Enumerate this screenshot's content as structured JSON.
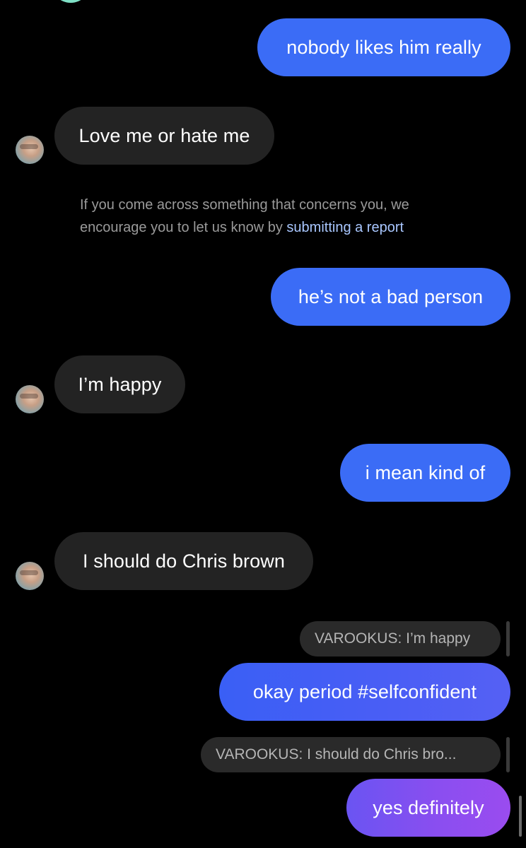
{
  "messages": [
    {
      "id": "m1",
      "direction": "sent",
      "text": "nobody likes him really"
    },
    {
      "id": "m2",
      "direction": "received",
      "text": "Love me or hate me"
    },
    {
      "id": "m3",
      "direction": "sent",
      "text": "he’s not a bad person"
    },
    {
      "id": "m4",
      "direction": "received",
      "text": "I’m happy"
    },
    {
      "id": "m5",
      "direction": "sent",
      "text": "i mean kind of"
    },
    {
      "id": "m6",
      "direction": "received",
      "text": "I should do Chris brown"
    },
    {
      "id": "m7",
      "direction": "sent",
      "text": "okay period #selfconfident",
      "reply_to": "VAROOKUS: I’m happy"
    },
    {
      "id": "m8",
      "direction": "sent",
      "text": "yes definitely",
      "reply_to": "VAROOKUS: I should do Chris bro..."
    }
  ],
  "safety_notice": {
    "text": "If you come across something that concerns you, we encourage you to let us know by",
    "link": "submitting a report"
  },
  "colors": {
    "background": "#000000",
    "sent_bubble": "#3b6cf6",
    "received_bubble": "#232323",
    "gradient_end": "#9a4cef",
    "link": "#a9c7ff"
  }
}
